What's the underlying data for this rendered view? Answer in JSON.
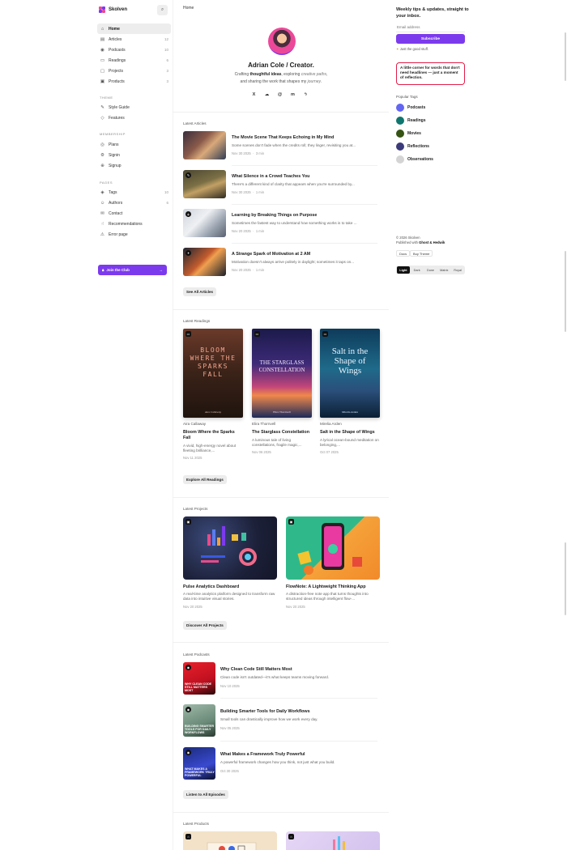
{
  "brand": {
    "name": "Skolven"
  },
  "sidebar": {
    "nav": [
      {
        "label": "Home",
        "count": "",
        "icon": "home-icon",
        "glyph": "⌂"
      },
      {
        "label": "Articles",
        "count": "12",
        "icon": "document-icon",
        "glyph": "▤"
      },
      {
        "label": "Podcasts",
        "count": "10",
        "icon": "microphone-icon",
        "glyph": "◉"
      },
      {
        "label": "Readings",
        "count": "6",
        "icon": "book-icon",
        "glyph": "▭"
      },
      {
        "label": "Projects",
        "count": "3",
        "icon": "folder-icon",
        "glyph": "▢"
      },
      {
        "label": "Products",
        "count": "3",
        "icon": "box-icon",
        "glyph": "▣"
      }
    ],
    "theme_label": "Theme",
    "theme": [
      {
        "label": "Style Guide",
        "icon": "brush-icon",
        "glyph": "✎"
      },
      {
        "label": "Features",
        "icon": "diamond-icon",
        "glyph": "◇"
      }
    ],
    "membership_label": "Membership",
    "membership": [
      {
        "label": "Plans",
        "icon": "plans-icon",
        "glyph": "◎"
      },
      {
        "label": "Signin",
        "icon": "signin-icon",
        "glyph": "⚙"
      },
      {
        "label": "Signup",
        "icon": "signup-icon",
        "glyph": "⊕"
      }
    ],
    "pages_label": "Pages",
    "pages": [
      {
        "label": "Tags",
        "count": "10",
        "icon": "tag-icon",
        "glyph": "◈"
      },
      {
        "label": "Authors",
        "count": "6",
        "icon": "user-icon",
        "glyph": "☺"
      },
      {
        "label": "Contact",
        "count": "",
        "icon": "mail-icon",
        "glyph": "✉"
      },
      {
        "label": "Recommendations",
        "count": "",
        "icon": "thumbs-up-icon",
        "glyph": "☝"
      },
      {
        "label": "Error page",
        "count": "",
        "icon": "error-icon",
        "glyph": "⚠"
      }
    ],
    "join_label": "Join the Club"
  },
  "main": {
    "breadcrumb": "Home",
    "hero": {
      "name": "Adrian Cole / Creator.",
      "line1_a": "Crafting ",
      "line1_b": "thoughtful ideas",
      "line1_c": ", exploring ",
      "line1_d": "creative paths",
      "line1_e": ",",
      "line2_a": "and sharing the work that shapes my ",
      "line2_b": "journey",
      "line2_c": "."
    },
    "socials": [
      {
        "icon": "x-icon",
        "glyph": "X"
      },
      {
        "icon": "bluesky-icon",
        "glyph": "☁"
      },
      {
        "icon": "threads-icon",
        "glyph": "@"
      },
      {
        "icon": "mastodon-icon",
        "glyph": "m"
      },
      {
        "icon": "bolt-icon",
        "glyph": "ϟ"
      }
    ],
    "articles_title": "Latest Articles",
    "articles": [
      {
        "title": "The Movie Scene That Keeps Echoing in My Mind",
        "excerpt": "Some scenes don't fade when the credits roll; they linger, revisiting you at...",
        "date": "Nov 30 2025",
        "read": "3 min"
      },
      {
        "title": "What Silence in a Crowd Teaches You",
        "excerpt": "There's a different kind of clarity that appears when you're surrounded by...",
        "date": "Nov 30 2025",
        "read": "1 min"
      },
      {
        "title": "Learning by Breaking Things on Purpose",
        "excerpt": "Sometimes the fastest way to understand how something works is to take ...",
        "date": "Nov 20 2025",
        "read": "1 min"
      },
      {
        "title": "A Strange Spark of Motivation at 2 AM",
        "excerpt": "Motivation doesn't always arrive politely in daylight; sometimes it taps on...",
        "date": "Nov 20 2025",
        "read": "1 min"
      }
    ],
    "articles_button": "See All Articles",
    "readings_title": "Latest Readings",
    "readings": [
      {
        "author": "Aira Callaway",
        "title": "Bloom Where the Sparks Fall",
        "desc": "A vivid, high-energy novel about fleeting brilliance,...",
        "date": "Nov 11 2025",
        "cover": "BLOOM WHERE THE SPARKS FALL",
        "cover_author": "Aira Callaway"
      },
      {
        "author": "Elira Thornvell",
        "title": "The Starglass Constellation",
        "desc": "A luminous tale of living constellations, fragile magic,...",
        "date": "Nov 06 2025",
        "cover": "THE STARGLASS CONSTELLATION",
        "cover_author": "Elira Thornvell"
      },
      {
        "author": "Mirelia Arden",
        "title": "Salt in the Shape of Wings",
        "desc": "A lyrical ocean-bound meditation on belonging,...",
        "date": "Oct 07 2025",
        "cover": "Salt in the Shape of Wings",
        "cover_author": "Mirelia Arden"
      }
    ],
    "readings_button": "Explore All Readings",
    "projects_title": "Latest Projects",
    "projects": [
      {
        "title": "Pulse Analytics Dashboard",
        "desc": "A real-time analytics platform designed to transform raw data into intuitive visual stories.",
        "date": "Nov 20 2025"
      },
      {
        "title": "FlowNote: A Lightweight Thinking App",
        "desc": "A distraction-free note app that turns thoughts into structured ideas through intelligent flow-...",
        "date": "Nov 20 2025"
      }
    ],
    "projects_button": "Discover All Projects",
    "podcasts_title": "Latest Podcasts",
    "podcasts": [
      {
        "title": "Why Clean Code Still Matters Most",
        "excerpt": "Clean code isn't outdated—it's what keeps teams moving forward.",
        "date": "Nov 10 2025",
        "thumb_text": "WHY CLEAN CODE STILL MATTERS MOST"
      },
      {
        "title": "Building Smarter Tools for Daily Workflows",
        "excerpt": "Small tools can drastically improve how we work every day.",
        "date": "Nov 05 2025",
        "thumb_text": "BUILDING SMARTER TOOLS FOR DAILY WORKFLOWS"
      },
      {
        "title": "What Makes a Framework Truly Powerful",
        "excerpt": "A powerful framework changes how you think, not just what you build.",
        "date": "Oct 30 2025",
        "thumb_text": "WHAT MAKES A FRAMEWORK TRULY POWERFUL"
      }
    ],
    "podcasts_button": "Listen to All Episodes",
    "products_title": "Latest Products"
  },
  "rail": {
    "newsletter_title": "Weekly tips & updates, straight to your inbox.",
    "email_placeholder": "Email address",
    "subscribe_label": "Subscribe",
    "good_stuff": "Just the good stuff.",
    "quote": "A little corner for words that don't need headlines — just a moment of reflection.",
    "popular_tags_title": "Popular Tags",
    "tags": [
      {
        "name": "Podcasts",
        "color": "#6366f1"
      },
      {
        "name": "Readings",
        "color": "#0f766e"
      },
      {
        "name": "Movies",
        "color": "#365314"
      },
      {
        "name": "Reflections",
        "color": "#3b3b7a"
      },
      {
        "name": "Observations",
        "color": "#d4d4d4"
      }
    ],
    "copyright_line1": "© 2026 Skolven",
    "copyright_line2_a": "Published with ",
    "copyright_line2_b": "Ghost & Hedwik",
    "docs_label": "Docs",
    "buy_label": "Buy Theme",
    "theme_options": [
      "Light",
      "Dark",
      "Dune",
      "Matrix",
      "Royal"
    ],
    "theme_selected": "Light"
  },
  "colors": {
    "accent": "#7c3aed",
    "quote_border": "#e11d48"
  }
}
